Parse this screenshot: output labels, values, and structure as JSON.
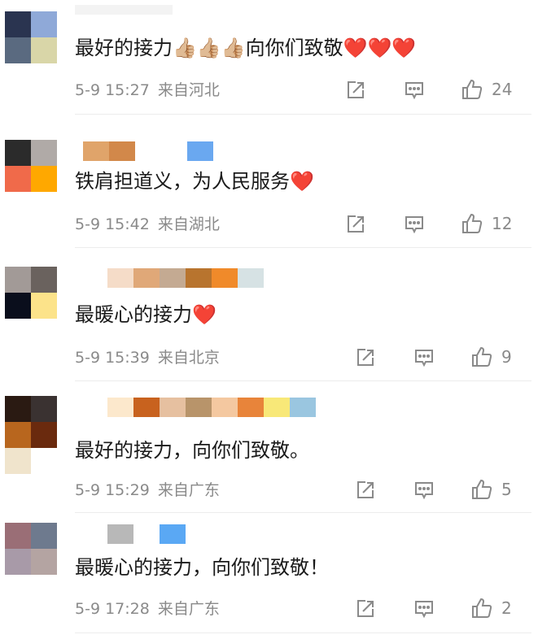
{
  "comments": [
    {
      "text": "最好的接力👍🏼👍🏼👍🏼向你们致敬❤️❤️❤️",
      "date": "5-9 15:27",
      "location": "来自河北",
      "likes": "24",
      "avatar_colors": [
        "#2a3450",
        "#8fa9d8",
        "#5a6a80",
        "#d9d6a8"
      ],
      "name_colors": [
        "#d9d9d9",
        "#ececec",
        "#e8e8e8"
      ]
    },
    {
      "text": "铁肩担道义，为人民服务❤️",
      "date": "5-9 15:42",
      "location": "来自湖北",
      "likes": "12",
      "avatar_colors": [
        "#2b2b2b",
        "#b0aaa7",
        "#f06a4a",
        "#ffa800"
      ],
      "name_colors": [
        "#e0a46a",
        "#d2884a",
        "#ffffff",
        "#ffffff",
        "#6aa8f0"
      ]
    },
    {
      "text": "最暖心的接力❤️",
      "date": "5-9 15:39",
      "location": "来自北京",
      "likes": "9",
      "avatar_colors": [
        "#a29a97",
        "#6a625e",
        "#0a0e1c",
        "#fce38a"
      ],
      "name_colors": [
        "#f5dcc8",
        "#e0a878",
        "#c4aa92",
        "#b8742e",
        "#f08a2a",
        "#d6e2e4"
      ]
    },
    {
      "text": "最好的接力，向你们致敬。",
      "date": "5-9 15:29",
      "location": "来自广东",
      "likes": "5",
      "avatar_colors": [
        "#2a1a12",
        "#3a3231",
        "#b8661e",
        "#6a2a0e",
        "#f0e4cc",
        "#ffffff"
      ],
      "name_colors": [
        "#fce8cc",
        "#c8621e",
        "#e6c0a0",
        "#b8946a",
        "#f4c8a0",
        "#e8843a",
        "#f8e878",
        "#9ac6e0"
      ]
    },
    {
      "text": "最暖心的接力，向你们致敬！",
      "date": "5-9 17:28",
      "location": "来自广东",
      "likes": "2",
      "avatar_colors": [
        "#9a6e76",
        "#6e7a8e",
        "#a89aa8",
        "#b4a4a2"
      ],
      "name_colors": [
        "#b8b8b8",
        "#ffffff",
        "#5aa8f4"
      ]
    }
  ]
}
